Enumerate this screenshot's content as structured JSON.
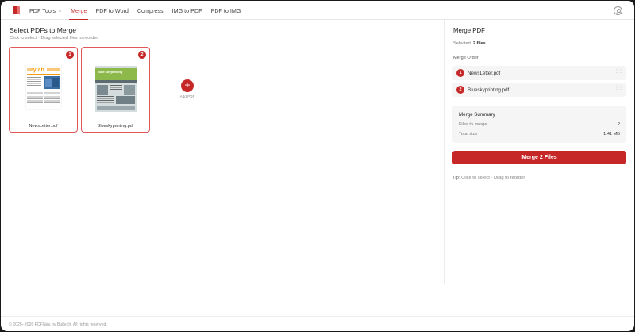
{
  "nav": {
    "items": [
      {
        "label": "PDF Tools",
        "dropdown": true
      },
      {
        "label": "Merge",
        "active": true
      },
      {
        "label": "PDF to Word"
      },
      {
        "label": "Compress"
      },
      {
        "label": "IMG to PDF"
      },
      {
        "label": "PDF to IMG"
      }
    ],
    "accent": "#c62828"
  },
  "left": {
    "title": "Select PDFs to Merge",
    "subtitle": "Click to select · Drag selected files to reorder",
    "files": [
      {
        "number": "1",
        "name": "NewsLetter.pdf",
        "thumb_title": "Drylab"
      },
      {
        "number": "2",
        "name": "Blueskyprinting.pdf",
        "thumb_title": "Blue skyprinting"
      }
    ],
    "add_label": "Add PDF"
  },
  "right": {
    "title": "Merge PDF",
    "selected_label": "Selected:",
    "selected_value": "2 files",
    "order_label": "Merge Order",
    "order": [
      {
        "number": "1",
        "name": "NewsLetter.pdf"
      },
      {
        "number": "2",
        "name": "Blueskyprinting.pdf"
      }
    ],
    "summary": {
      "title": "Merge Summary",
      "rows": [
        {
          "label": "Files to merge",
          "value": "2"
        },
        {
          "label": "Total size",
          "value": "1.41 MB"
        }
      ]
    },
    "merge_button": "Merge 2 Files",
    "tip_label": "Tip:",
    "tip_text": "Click to select · Drag to reorder"
  },
  "footer": "© 2025–2026 PDFNau by Bultech. All rights reserved."
}
